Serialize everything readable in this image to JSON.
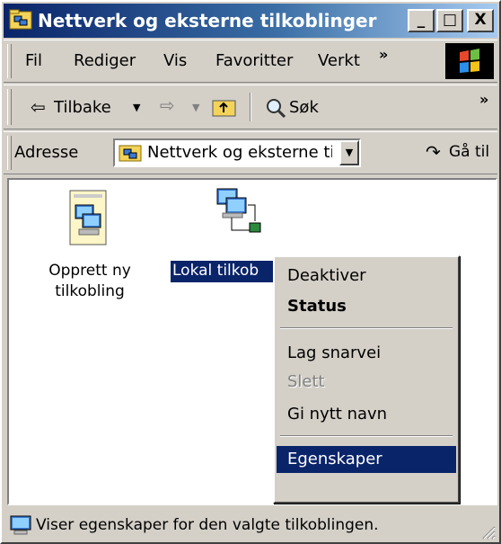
{
  "window": {
    "title": "Nettverk og eksterne tilkoblinger"
  },
  "title_buttons": {
    "minimize": "_",
    "maximize": "□",
    "close": "X"
  },
  "menubar": {
    "items": [
      "Fil",
      "Rediger",
      "Vis",
      "Favoritter",
      "Verkt"
    ],
    "overflow": "»"
  },
  "toolbar": {
    "back_label": "Tilbake",
    "search_label": "Søk",
    "overflow": "»"
  },
  "address": {
    "label": "Adresse",
    "value": "Nettverk og eksterne tilkoblinger",
    "go_label": "Gå til"
  },
  "icons": [
    {
      "label": "Opprett ny tilkobling"
    },
    {
      "label": "Lokal tilkob"
    }
  ],
  "context_menu": {
    "items": [
      "Deaktiver",
      "Status",
      "Lag snarvei",
      "Slett",
      "Gi nytt navn",
      "Egenskaper"
    ],
    "bold_item": "Status",
    "disabled_item": "Slett",
    "highlighted_item": "Egenskaper"
  },
  "statusbar": {
    "text": "Viser egenskaper for den valgte tilkoblingen."
  },
  "colors": {
    "title_start": "#0a246a",
    "title_end": "#a6caf0",
    "selection": "#0a246a",
    "face": "#d4d0c8"
  }
}
